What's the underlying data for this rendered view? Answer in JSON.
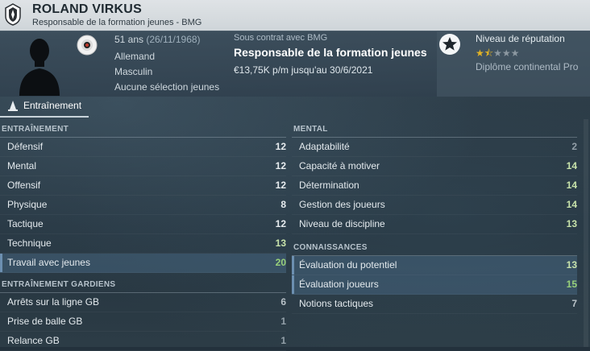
{
  "profile": {
    "name": "ROLAND VIRKUS",
    "subtitle": "Responsable de la formation jeunes - BMG",
    "age": "51 ans",
    "birth_date": "(26/11/1968)",
    "nationality": "Allemand",
    "gender": "Masculin",
    "selections": "Aucune sélection jeunes",
    "contract_status": "Sous contrat avec BMG",
    "role": "Responsable de la formation jeunes",
    "wage": "€13,75K p/m jusqu'au 30/6/2021",
    "reputation_label": "Niveau de réputation",
    "reputation_stars": 1.5,
    "reputation_max": 5,
    "diploma": "Diplôme continental Pro"
  },
  "icons": {
    "club": "club-badge-icon",
    "avatar": "person-silhouette-icon",
    "flag": "nationality-flag-icon",
    "reputation": "star-badge-icon",
    "tab": "training-cone-icon"
  },
  "tabs": [
    {
      "label": "Entraînement",
      "active": true
    }
  ],
  "colors": {
    "value_high": "#98d07a",
    "value_mid": "#c8e3ab",
    "value_low": "#93a0a9",
    "star": "#e2b325"
  },
  "sections": {
    "training": {
      "title": "ENTRAÎNEMENT",
      "rows": [
        {
          "name": "Défensif",
          "value": "12"
        },
        {
          "name": "Mental",
          "value": "12"
        },
        {
          "name": "Offensif",
          "value": "12"
        },
        {
          "name": "Physique",
          "value": "8"
        },
        {
          "name": "Tactique",
          "value": "12"
        },
        {
          "name": "Technique",
          "value": "13"
        },
        {
          "name": "Travail avec jeunes",
          "value": "20"
        }
      ]
    },
    "goalkeeping": {
      "title": "ENTRAÎNEMENT GARDIENS",
      "rows": [
        {
          "name": "Arrêts sur la ligne GB",
          "value": "6"
        },
        {
          "name": "Prise de balle GB",
          "value": "1"
        },
        {
          "name": "Relance GB",
          "value": "1"
        }
      ]
    },
    "mental": {
      "title": "MENTAL",
      "rows": [
        {
          "name": "Adaptabilité",
          "value": "2"
        },
        {
          "name": "Capacité à motiver",
          "value": "14"
        },
        {
          "name": "Détermination",
          "value": "14"
        },
        {
          "name": "Gestion des joueurs",
          "value": "14"
        },
        {
          "name": "Niveau de discipline",
          "value": "13"
        }
      ]
    },
    "knowledge": {
      "title": "CONNAISSANCES",
      "rows": [
        {
          "name": "Évaluation du potentiel",
          "value": "13"
        },
        {
          "name": "Évaluation joueurs",
          "value": "15"
        },
        {
          "name": "Notions tactiques",
          "value": "7"
        }
      ]
    }
  }
}
